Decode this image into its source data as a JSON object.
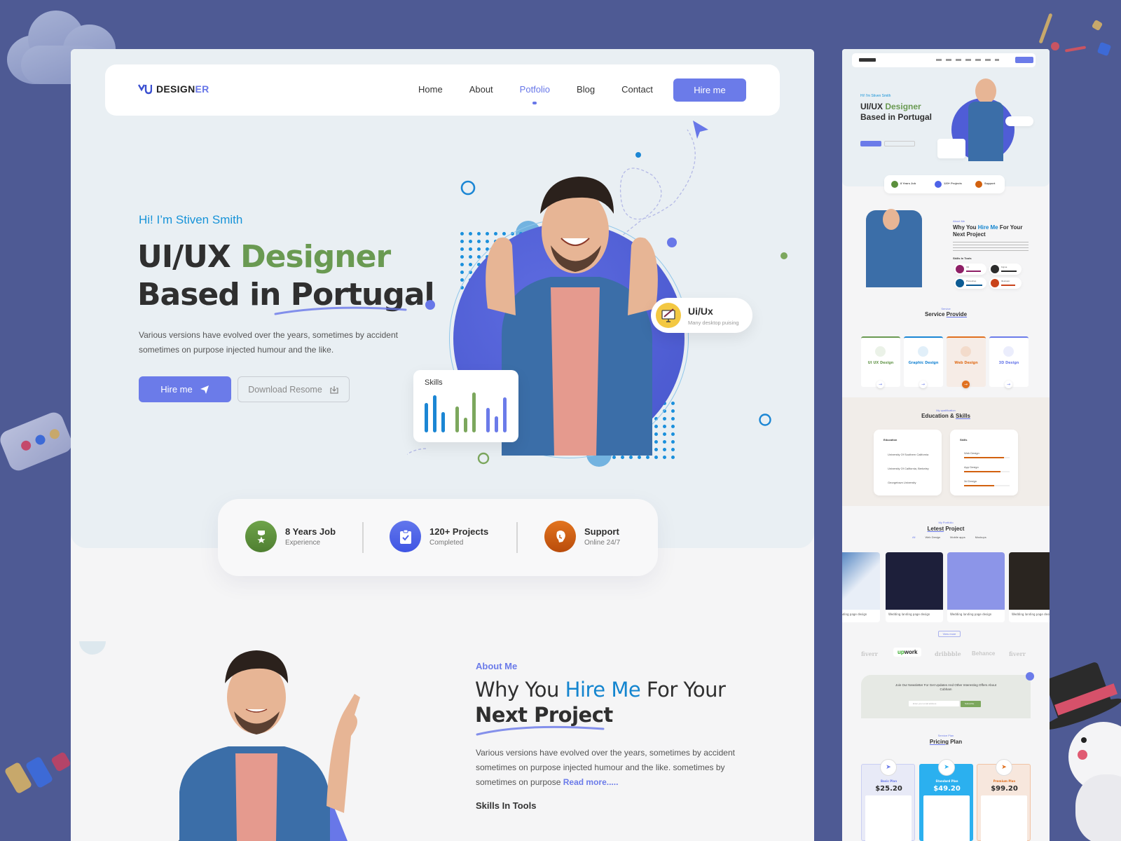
{
  "brand": {
    "logo_prefix": "DESIGN",
    "logo_suffix": "ER"
  },
  "nav": {
    "items": [
      {
        "label": "Home",
        "active": false
      },
      {
        "label": "About",
        "active": false
      },
      {
        "label": "Potfolio",
        "active": true
      },
      {
        "label": "Blog",
        "active": false
      },
      {
        "label": "Contact",
        "active": false
      }
    ],
    "cta": "Hire me"
  },
  "hero": {
    "greeting": "Hi! I’m Stiven Smith",
    "title_part1": "UI/UX ",
    "title_highlight": "Designer",
    "title_line2": "Based in Portugal",
    "description": "Various versions have evolved over the years, sometimes by accident sometimes on purpose injected humour and the like.",
    "primary_button": "Hire me",
    "secondary_button": "Download Resome",
    "skills_card": {
      "title": "Skills",
      "bars": [
        {
          "value": 0.72,
          "color": "#1b86d4"
        },
        {
          "value": 0.92,
          "color": "#1b86d4"
        },
        {
          "value": 0.5,
          "color": "#1b86d4"
        },
        {
          "value": 0.63,
          "color": "#7ca75d"
        },
        {
          "value": 0.36,
          "color": "#7ca75d"
        },
        {
          "value": 0.98,
          "color": "#7ca75d"
        },
        {
          "value": 0.6,
          "color": "#6b7be9"
        },
        {
          "value": 0.4,
          "color": "#6b7be9"
        },
        {
          "value": 0.86,
          "color": "#6b7be9"
        }
      ]
    },
    "badge": {
      "title": "Ui/Ux",
      "subtitle": "Many desktop puising"
    }
  },
  "stats": [
    {
      "title": "8 Years Job",
      "subtitle": "Experience",
      "icon": "award-icon",
      "color": "#5b8f3c"
    },
    {
      "title": "120+ Projects",
      "subtitle": "Completed",
      "icon": "clipboard-check-icon",
      "color": "#4d63e8"
    },
    {
      "title": "Support",
      "subtitle": "Online 24/7",
      "icon": "headset-icon",
      "color": "#d2610f"
    }
  ],
  "about": {
    "label": "About Me",
    "heading_part1": "Why You ",
    "heading_highlight": "Hire Me",
    "heading_part2": " For Your",
    "heading_line2": "Next Project",
    "description": "Various versions have evolved over the years, sometimes by accident sometimes on purpose injected humour and the like. sometimes by sometimes on purpose ",
    "read_more": "Read more.....",
    "skills_heading": "Skills In Tools"
  },
  "preview": {
    "hero": {
      "greeting": "Hi! I'm Stiven Smith",
      "title1": "UI/UX ",
      "title_hl": "Designer",
      "title2": "Based in Portugal"
    },
    "stats": [
      "8 Years Job",
      "120+ Projects",
      "Support"
    ],
    "about": {
      "label": "About Me",
      "h1": "Why You ",
      "hl": "Hire Me",
      "h2": " For Your",
      "h3": "Next Project",
      "skills_heading": "Skills In Tools",
      "tools": [
        {
          "name": "XD",
          "color": "#8e1f66",
          "fill": 0.8
        },
        {
          "name": "Figma",
          "color": "#2b2b2b",
          "fill": 0.85
        },
        {
          "name": "Photoshop",
          "color": "#0c5b93",
          "fill": 0.9
        },
        {
          "name": "Illustrator",
          "color": "#c9431a",
          "fill": 0.75
        }
      ]
    },
    "services": {
      "label": "Service",
      "title_plain": "Service ",
      "title_ul": "Provide",
      "items": [
        {
          "name": "UI UX Design",
          "color": "#6a9a52"
        },
        {
          "name": "Graphic Design",
          "color": "#1b86d4"
        },
        {
          "name": "Web Design",
          "color": "#e0701f"
        },
        {
          "name": "3D Design",
          "color": "#6b7be9"
        }
      ]
    },
    "qualification": {
      "label": "My qualification",
      "title_plain": "Education & ",
      "title_ul": "Skills",
      "education_title": "Education",
      "education": [
        "University Of Southern California",
        "University Of California, Berkeley",
        "Georgetown University"
      ],
      "skills_title": "Skills",
      "skills": [
        {
          "name": "Web Design",
          "value": 0.88
        },
        {
          "name": "App Design",
          "value": 0.8
        },
        {
          "name": "3d Design",
          "value": 0.66
        }
      ]
    },
    "portfolio": {
      "label": "My Portfolio",
      "title_ul": "Letest",
      "title_plain": " Project",
      "filters": [
        "All",
        "Web Design",
        "Mobile apps",
        "Mockups"
      ],
      "projects": [
        "Wedding landing page design",
        "Wedding landing page design",
        "Wedding landing page design",
        "Wedding landing page design"
      ],
      "view_more": "View more"
    },
    "brands": [
      "fiverr",
      "upwork",
      "dribbble",
      "Behance",
      "fiverr"
    ],
    "newsletter": {
      "text": "Join Our Newsletter For Get Updates And Other Interesting Offers About Cobham",
      "placeholder": "Enter your email address",
      "button": "Subscribe"
    },
    "pricing": {
      "label": "Service Plan",
      "title_ul": "Pricing",
      "title_plain": " Plan",
      "plans": [
        {
          "name": "Basic Plan",
          "price": "$25.20"
        },
        {
          "name": "Standard Plan",
          "price": "$49.20"
        },
        {
          "name": "Premium Plan",
          "price": "$99.20"
        }
      ]
    }
  }
}
